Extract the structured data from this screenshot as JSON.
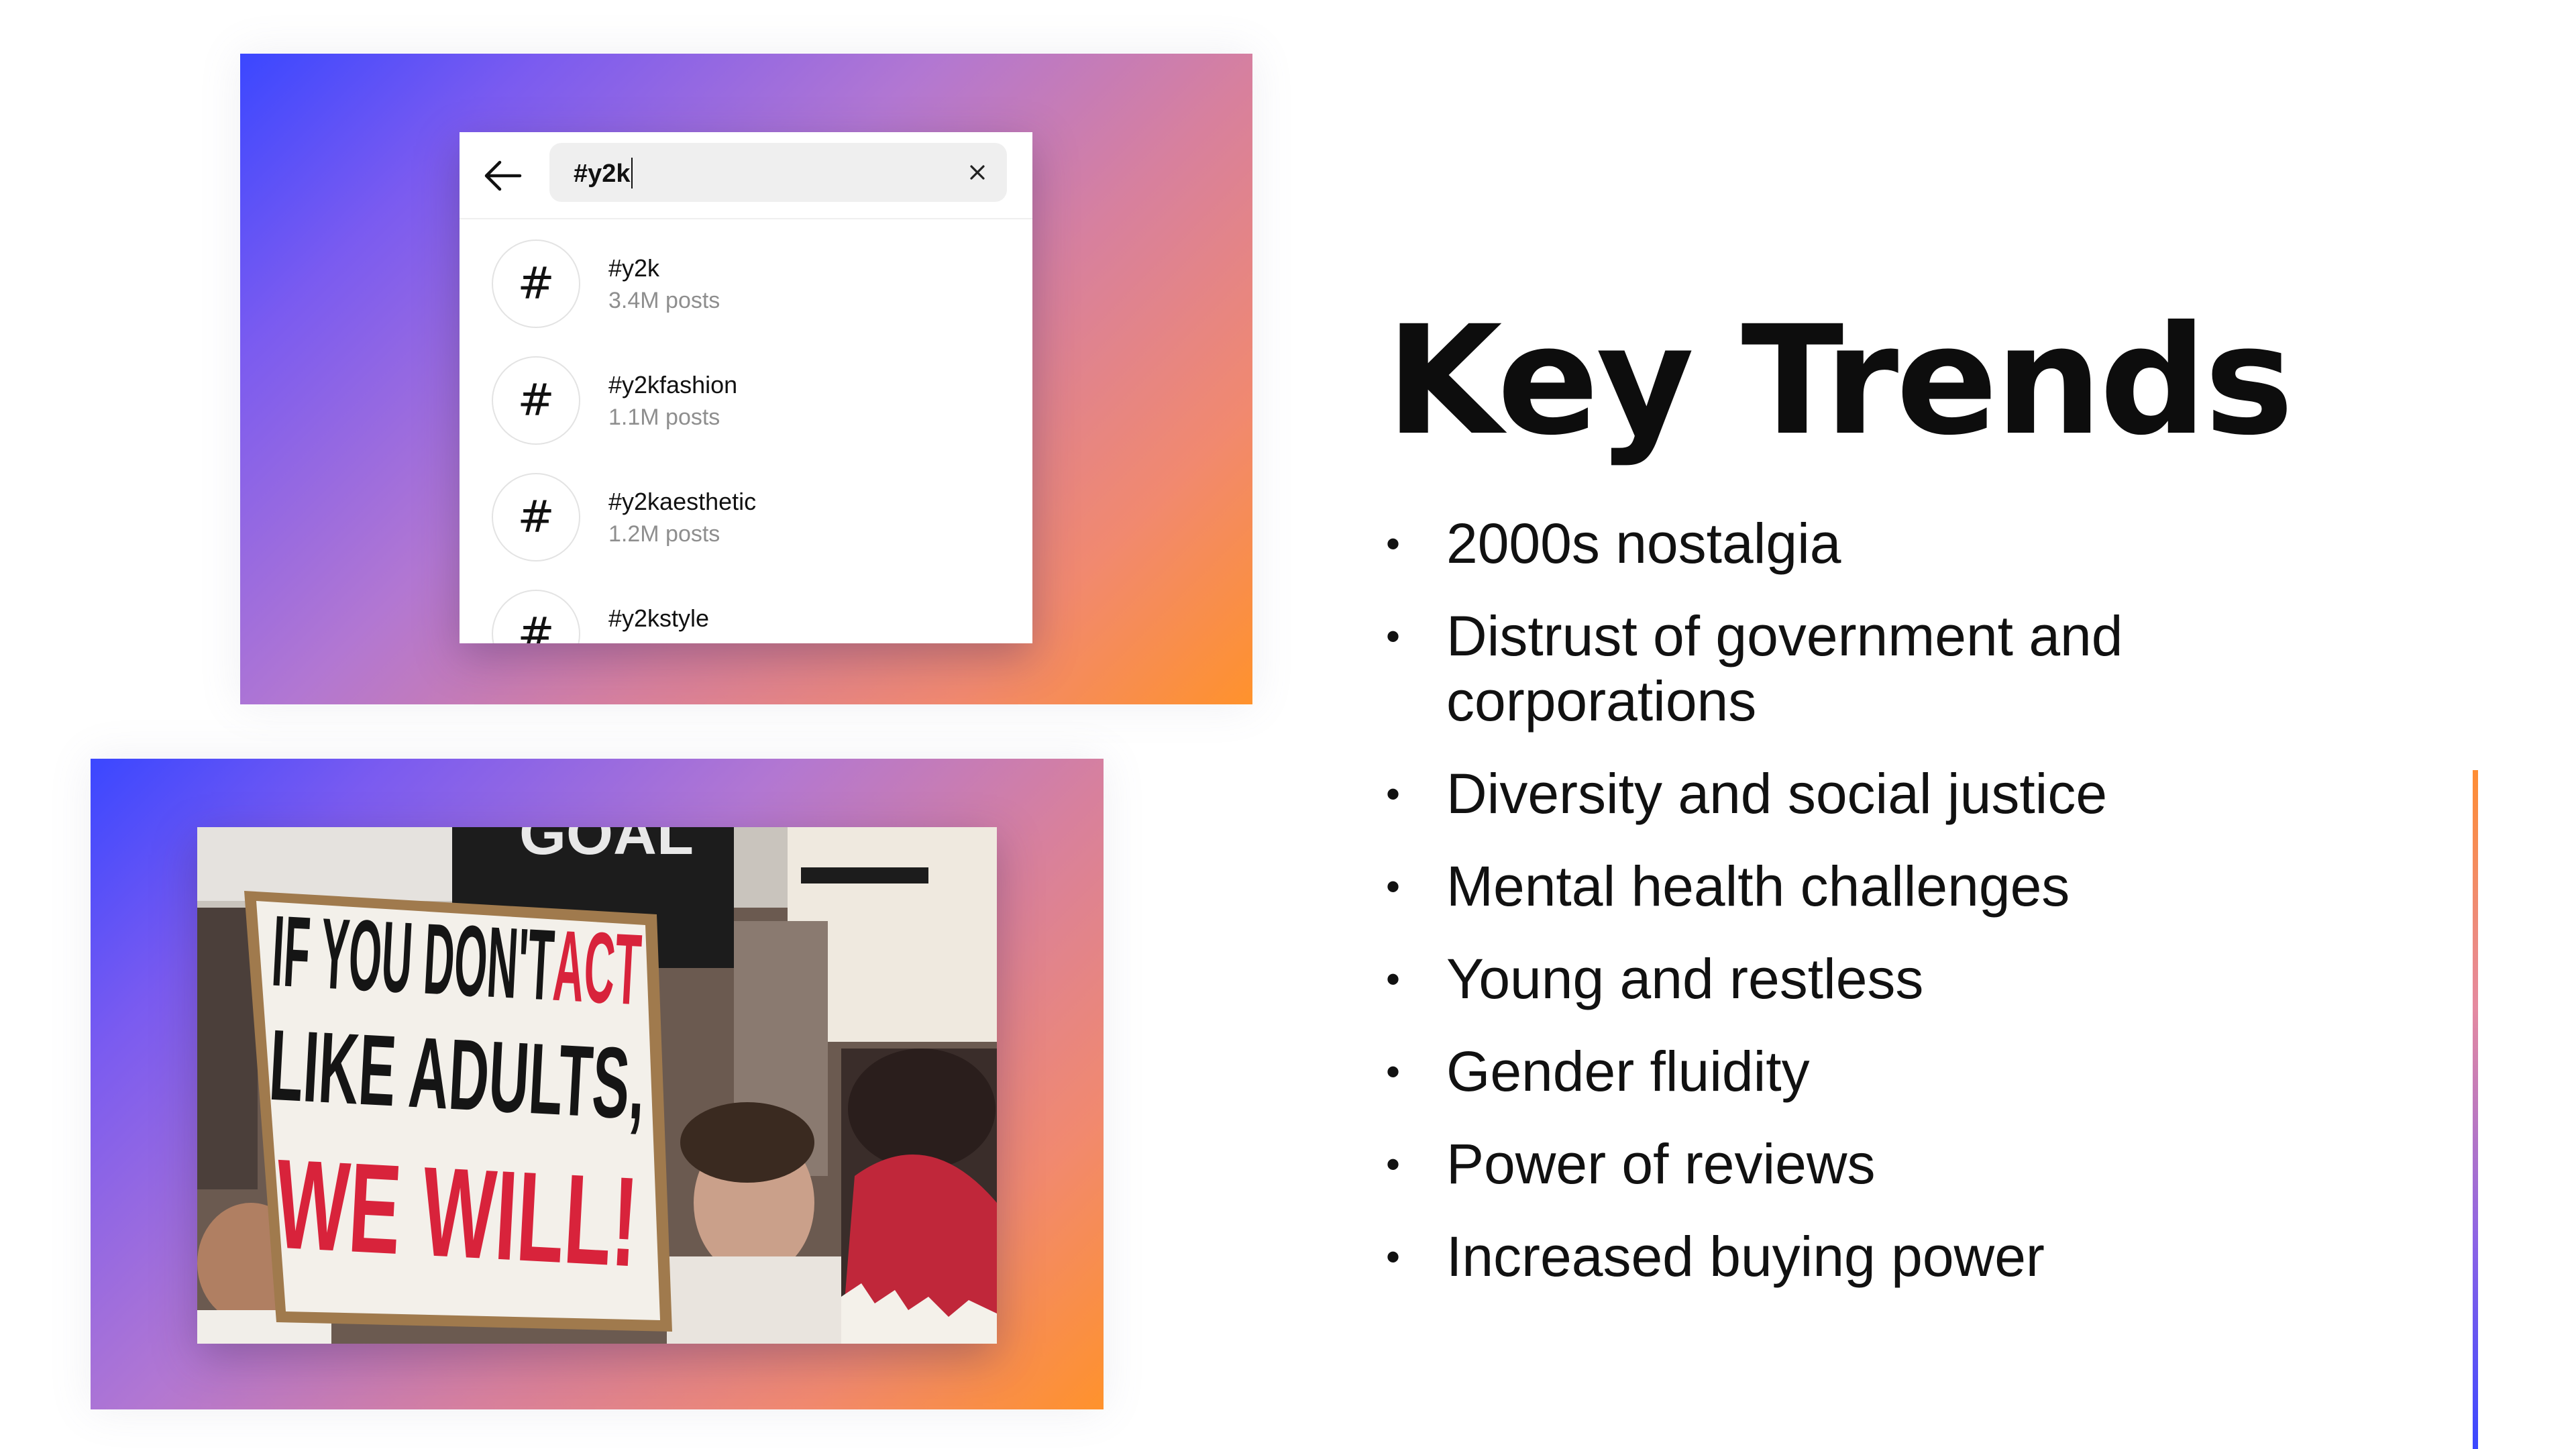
{
  "search": {
    "query": "#y2k",
    "results": [
      {
        "symbol": "#",
        "tag": "#y2k",
        "count": "3.4M posts"
      },
      {
        "symbol": "#",
        "tag": "#y2kfashion",
        "count": "1.1M posts"
      },
      {
        "symbol": "#",
        "tag": "#y2kaesthetic",
        "count": "1.2M posts"
      },
      {
        "symbol": "#",
        "tag": "#y2kstyle",
        "count": ""
      }
    ]
  },
  "photo": {
    "sign_line1_black": "IF YOU DON'T",
    "sign_line1_red": "ACT",
    "sign_line2": "LIKE ADULTS,",
    "sign_line3": "WE WILL!",
    "banner_text": "GOAL"
  },
  "slide": {
    "title": "Key Trends",
    "bullets": [
      "2000s nostalgia",
      "Distrust of government and corporations",
      "Diversity and social justice",
      "Mental health challenges",
      "Young and restless",
      "Gender fluidity",
      "Power of reviews",
      "Increased buying power"
    ]
  },
  "colors": {
    "gradient_start": "#3b47ff",
    "gradient_mid": "#b277d2",
    "gradient_end": "#ff922c",
    "sign_red": "#d8233b"
  }
}
